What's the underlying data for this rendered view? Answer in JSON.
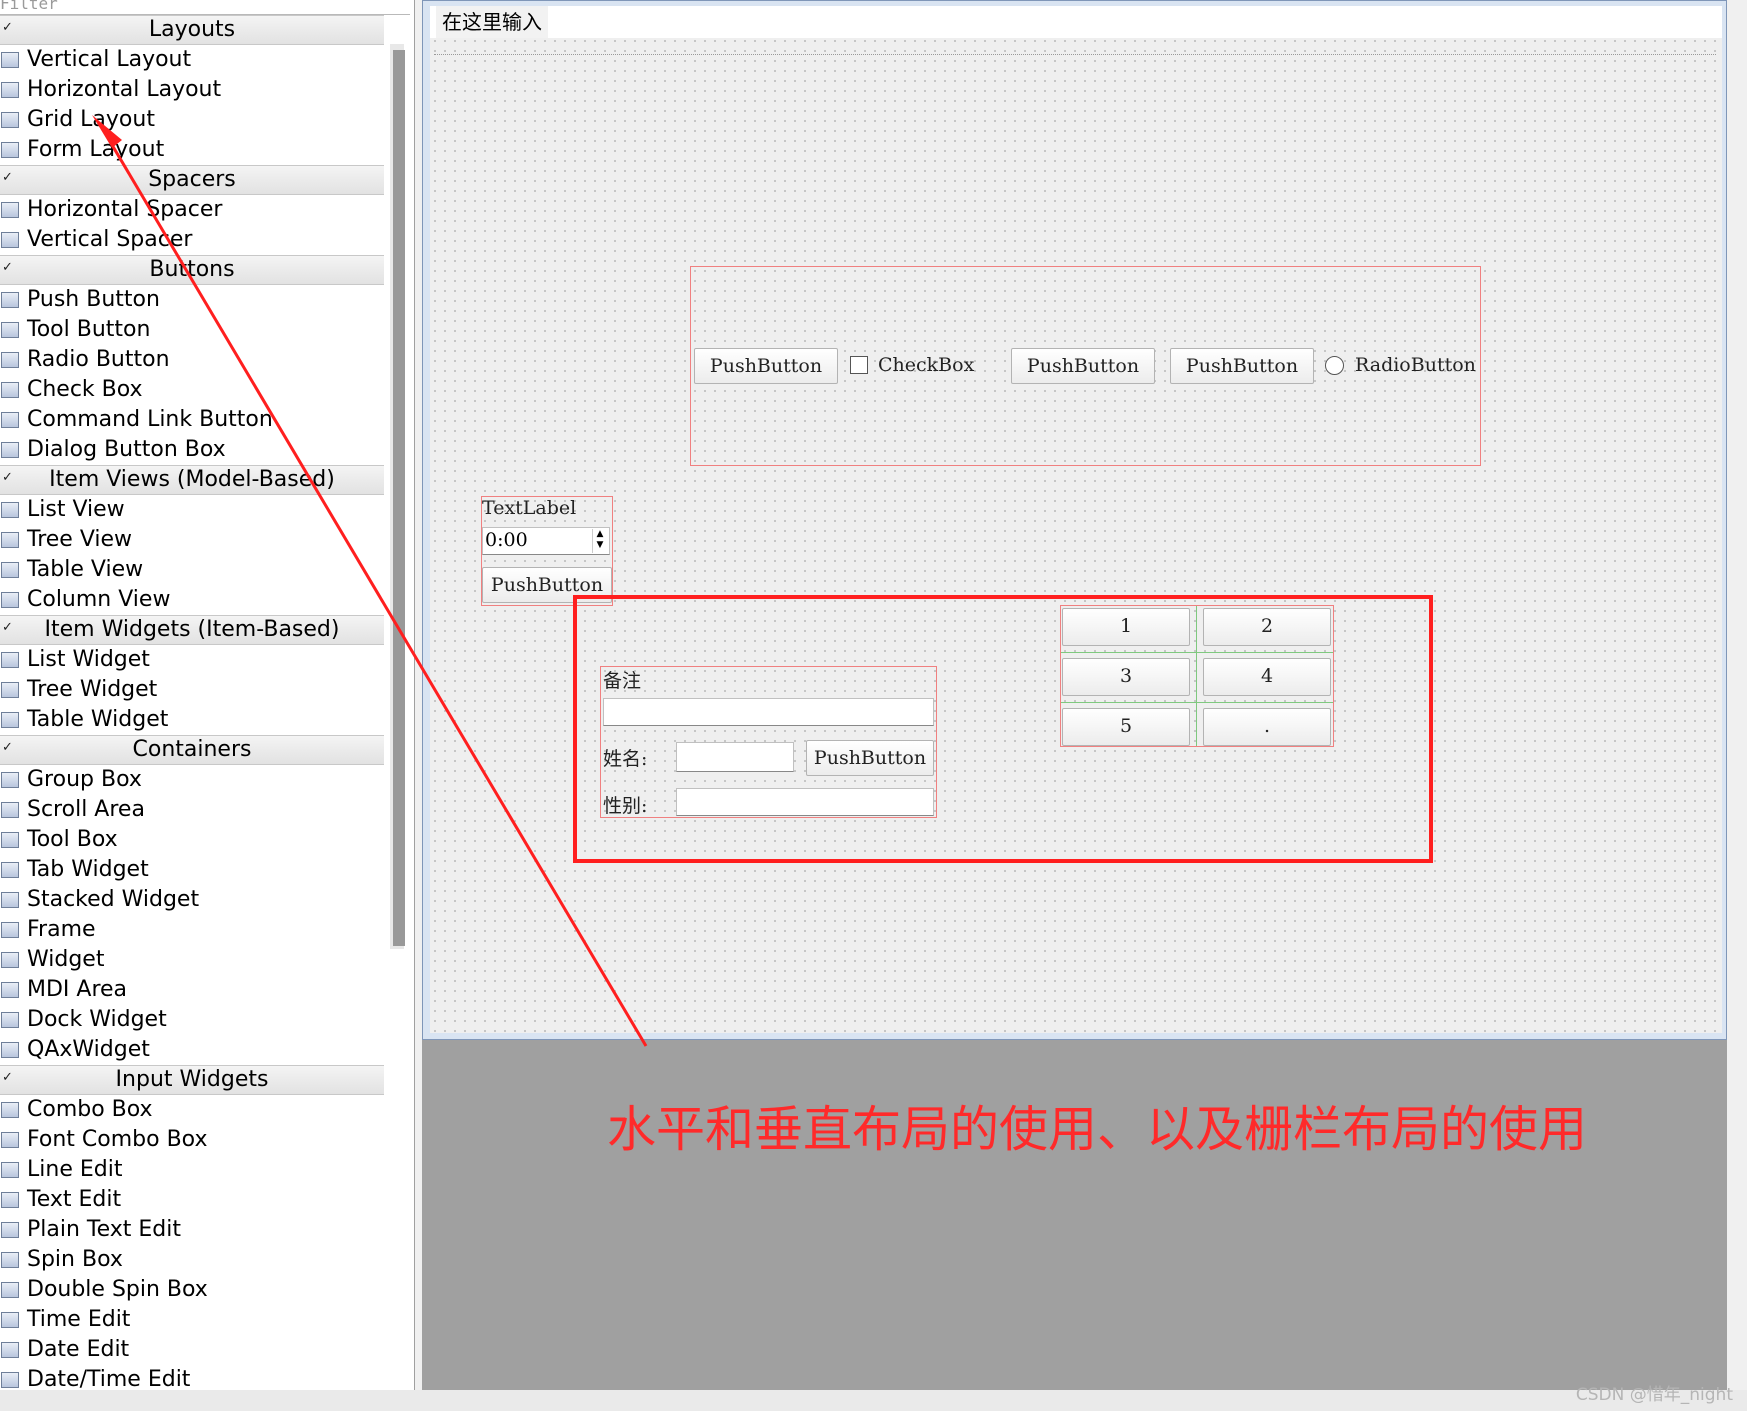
{
  "filter": {
    "placeholder": "Filter"
  },
  "categories": [
    {
      "label": "Layouts",
      "items": [
        "Vertical Layout",
        "Horizontal Layout",
        "Grid Layout",
        "Form Layout"
      ]
    },
    {
      "label": "Spacers",
      "items": [
        "Horizontal Spacer",
        "Vertical Spacer"
      ]
    },
    {
      "label": "Buttons",
      "items": [
        "Push Button",
        "Tool Button",
        "Radio Button",
        "Check Box",
        "Command Link Button",
        "Dialog Button Box"
      ]
    },
    {
      "label": "Item Views (Model-Based)",
      "items": [
        "List View",
        "Tree View",
        "Table View",
        "Column View"
      ]
    },
    {
      "label": "Item Widgets (Item-Based)",
      "items": [
        "List Widget",
        "Tree Widget",
        "Table Widget"
      ]
    },
    {
      "label": "Containers",
      "items": [
        "Group Box",
        "Scroll Area",
        "Tool Box",
        "Tab Widget",
        "Stacked Widget",
        "Frame",
        "Widget",
        "MDI Area",
        "Dock Widget",
        "QAxWidget"
      ]
    },
    {
      "label": "Input Widgets",
      "items": [
        "Combo Box",
        "Font Combo Box",
        "Line Edit",
        "Text Edit",
        "Plain Text Edit",
        "Spin Box",
        "Double Spin Box",
        "Time Edit",
        "Date Edit",
        "Date/Time Edit"
      ]
    }
  ],
  "menubar": {
    "placeholder": "在这里输入"
  },
  "hlayout": {
    "btn1": "PushButton",
    "check": "CheckBox",
    "btn2": "PushButton",
    "btn3": "PushButton",
    "radio": "RadioButton"
  },
  "vlayout": {
    "label": "TextLabel",
    "time": "0:00",
    "button": "PushButton"
  },
  "form": {
    "note_label": "备注",
    "name_label": "姓名:",
    "name_button": "PushButton",
    "gender_label": "性别:"
  },
  "grid": {
    "buttons": [
      "1",
      "2",
      "3",
      "4",
      "5",
      "."
    ]
  },
  "caption": "水平和垂直布局的使用、以及栅栏布局的使用",
  "watermark": "CSDN @惜年_night",
  "colors": {
    "annotation": "#ff1f1f",
    "layout_outline": "#f08080"
  }
}
